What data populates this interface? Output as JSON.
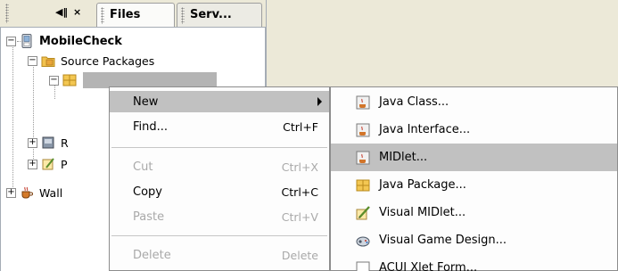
{
  "tabs": {
    "panel_controls": {
      "restore_glyph": "◀‖",
      "close_glyph": "×"
    },
    "items": [
      {
        "label": "Files"
      },
      {
        "label": "Serv..."
      }
    ]
  },
  "tree": {
    "root": {
      "label": "MobileCheck"
    },
    "source_packages": {
      "label": "Source Packages"
    },
    "row_r": {
      "label": "R"
    },
    "row_p": {
      "label": "P"
    },
    "wall": {
      "label": "Wall"
    }
  },
  "context_menu": {
    "items": [
      {
        "label": "New",
        "accelerator": "",
        "state": "selected"
      },
      {
        "label": "Find...",
        "accelerator": "Ctrl+F",
        "state": "enabled"
      },
      {
        "label": "Cut",
        "accelerator": "Ctrl+X",
        "state": "disabled"
      },
      {
        "label": "Copy",
        "accelerator": "Ctrl+C",
        "state": "enabled"
      },
      {
        "label": "Paste",
        "accelerator": "Ctrl+V",
        "state": "disabled"
      },
      {
        "label": "Delete",
        "accelerator": "Delete",
        "state": "disabled"
      }
    ]
  },
  "new_submenu": {
    "items": [
      {
        "label": "Java Class...",
        "icon": "java-class-icon"
      },
      {
        "label": "Java Interface...",
        "icon": "java-interface-icon"
      },
      {
        "label": "MIDlet...",
        "icon": "midlet-icon",
        "state": "selected"
      },
      {
        "label": "Java Package...",
        "icon": "package-icon"
      },
      {
        "label": "Visual MIDlet...",
        "icon": "visual-midlet-icon"
      },
      {
        "label": "Visual Game Design...",
        "icon": "game-design-icon"
      },
      {
        "label": "ACUI Xlet Form...",
        "icon": "form-icon"
      }
    ]
  },
  "colors": {
    "chrome": "#ece9d8",
    "selection": "#c1c1c1",
    "disabled_text": "#a9a9a9"
  }
}
